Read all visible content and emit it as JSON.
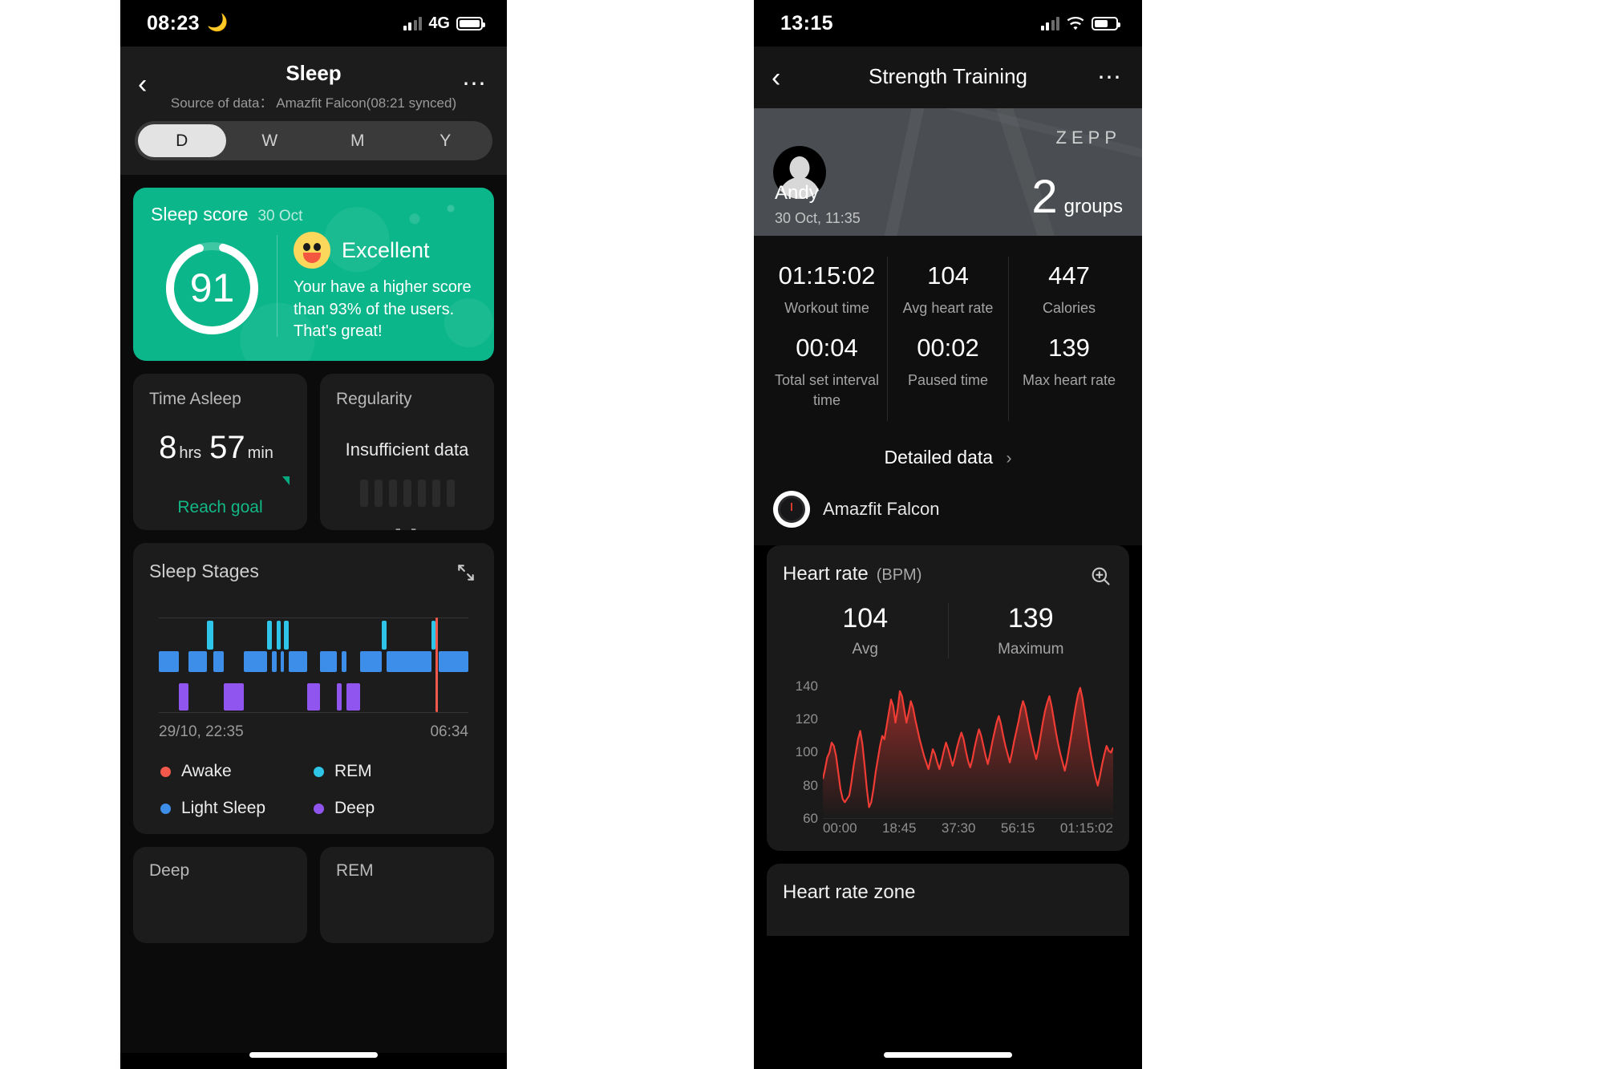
{
  "left": {
    "status": {
      "time": "08:23",
      "moon_icon": "moon-icon",
      "network": "4G"
    },
    "nav": {
      "back_icon": "chevron-left-icon",
      "title": "Sleep",
      "subtitle": "Source of data： Amazfit Falcon(08:21 synced)",
      "more_icon": "more-horizontal-icon"
    },
    "segments": [
      {
        "label": "D",
        "selected": true
      },
      {
        "label": "W",
        "selected": false
      },
      {
        "label": "M",
        "selected": false
      },
      {
        "label": "Y",
        "selected": false
      }
    ],
    "score_card": {
      "title": "Sleep score",
      "date": "30 Oct",
      "score": "91",
      "score_value": 91,
      "rating": "Excellent",
      "emoji_icon": "smiley-face-icon",
      "message": "Your have a higher score than 93% of the users. That's great!",
      "accent": "#0ab68a"
    },
    "time_asleep": {
      "title": "Time Asleep",
      "hours": "8",
      "hours_unit": "hrs",
      "minutes": "57",
      "minutes_unit": "min",
      "status": "Reach goal",
      "status_color": "#12b886"
    },
    "regularity": {
      "title": "Regularity",
      "value": "Insufficient data",
      "placeholder": "- -"
    },
    "sleep_stages": {
      "title": "Sleep Stages",
      "expand_icon": "expand-icon",
      "start_time": "29/10, 22:35",
      "end_time": "06:34",
      "legend": [
        {
          "label": "Awake",
          "color": "#f2584b"
        },
        {
          "label": "REM",
          "color": "#2ec5e8"
        },
        {
          "label": "Light Sleep",
          "color": "#3d8ee8"
        },
        {
          "label": "Deep",
          "color": "#9155ef"
        }
      ]
    },
    "bottom_cards": [
      {
        "title": "Deep"
      },
      {
        "title": "REM"
      }
    ],
    "chart_data": {
      "type": "area",
      "title": "Sleep Stages",
      "xlabel": "",
      "ylabel": "",
      "legend_position": "bottom",
      "categories": [
        "Awake",
        "REM",
        "Light Sleep",
        "Deep"
      ],
      "x": [
        "29/10, 22:35",
        "06:34"
      ],
      "segments": [
        {
          "stage": "Light Sleep",
          "start": 0.0,
          "end": 6.5
        },
        {
          "stage": "Deep",
          "start": 6.5,
          "end": 9.5
        },
        {
          "stage": "Light Sleep",
          "start": 9.5,
          "end": 15.5
        },
        {
          "stage": "REM",
          "start": 15.5,
          "end": 17.5
        },
        {
          "stage": "Light Sleep",
          "start": 17.5,
          "end": 21.0
        },
        {
          "stage": "Deep",
          "start": 21.0,
          "end": 27.5
        },
        {
          "stage": "Light Sleep",
          "start": 27.5,
          "end": 35.0
        },
        {
          "stage": "REM",
          "start": 35.0,
          "end": 36.5
        },
        {
          "stage": "Light Sleep",
          "start": 36.5,
          "end": 38.0
        },
        {
          "stage": "REM",
          "start": 38.0,
          "end": 39.5
        },
        {
          "stage": "Light Sleep",
          "start": 39.5,
          "end": 40.5
        },
        {
          "stage": "REM",
          "start": 40.5,
          "end": 42.0
        },
        {
          "stage": "Light Sleep",
          "start": 42.0,
          "end": 48.0
        },
        {
          "stage": "Deep",
          "start": 48.0,
          "end": 52.0
        },
        {
          "stage": "Light Sleep",
          "start": 52.0,
          "end": 57.5
        },
        {
          "stage": "Deep",
          "start": 57.5,
          "end": 59.0
        },
        {
          "stage": "Light Sleep",
          "start": 59.0,
          "end": 60.5
        },
        {
          "stage": "Deep",
          "start": 60.5,
          "end": 65.0
        },
        {
          "stage": "Light Sleep",
          "start": 65.0,
          "end": 72.0
        },
        {
          "stage": "REM",
          "start": 72.0,
          "end": 73.5
        },
        {
          "stage": "Light Sleep",
          "start": 73.5,
          "end": 88.0
        },
        {
          "stage": "REM",
          "start": 88.0,
          "end": 89.5
        },
        {
          "stage": "Awake",
          "start": 89.5,
          "end": 90.5
        },
        {
          "stage": "Light Sleep",
          "start": 90.5,
          "end": 100.0
        }
      ]
    }
  },
  "right": {
    "status": {
      "time": "13:15",
      "wifi_icon": "wifi-icon"
    },
    "nav": {
      "back_icon": "chevron-left-icon",
      "title": "Strength Training",
      "more_icon": "more-horizontal-icon"
    },
    "hero": {
      "avatar_icon": "avatar-icon",
      "user_name": "Andy",
      "datetime": "30 Oct, 11:35",
      "brand": "ΖΕΡΡ",
      "groups_value": "2",
      "groups_label": "groups"
    },
    "stats": [
      {
        "value": "01:15:02",
        "label": "Workout time"
      },
      {
        "value": "104",
        "label": "Avg heart rate"
      },
      {
        "value": "447",
        "label": "Calories"
      },
      {
        "value": "00:04",
        "label": "Total set interval time"
      },
      {
        "value": "00:02",
        "label": "Paused time"
      },
      {
        "value": "139",
        "label": "Max heart rate"
      }
    ],
    "detailed_data": {
      "label": "Detailed data",
      "chevron_icon": "chevron-right-icon"
    },
    "device": {
      "name": "Amazfit Falcon",
      "icon": "watch-icon"
    },
    "heart_rate": {
      "title": "Heart rate",
      "unit": "(BPM)",
      "zoom_icon": "zoom-in-icon",
      "avg_value": "104",
      "avg_label": "Avg",
      "max_value": "139",
      "max_label": "Maximum",
      "line_color": "#f03c34"
    },
    "heart_rate_zone": {
      "title": "Heart rate zone"
    },
    "chart_data": {
      "type": "line",
      "title": "Heart rate (BPM)",
      "xlabel": "",
      "ylabel": "BPM",
      "ylim": [
        60,
        150
      ],
      "yticks": [
        60,
        80,
        100,
        120,
        140
      ],
      "xticks": [
        "00:00",
        "18:45",
        "37:30",
        "56:15",
        "01:15:02"
      ],
      "grid": false,
      "legend_position": "none",
      "series": [
        {
          "name": "Heart rate",
          "color": "#f03c34",
          "values": [
            84,
            90,
            97,
            100,
            106,
            104,
            98,
            88,
            78,
            72,
            70,
            72,
            74,
            82,
            92,
            100,
            108,
            113,
            105,
            92,
            78,
            67,
            70,
            78,
            88,
            96,
            104,
            110,
            108,
            116,
            124,
            132,
            128,
            118,
            126,
            137,
            134,
            126,
            118,
            124,
            131,
            127,
            120,
            114,
            108,
            103,
            98,
            94,
            90,
            96,
            102,
            99,
            94,
            90,
            95,
            101,
            106,
            102,
            97,
            92,
            97,
            103,
            108,
            112,
            108,
            101,
            95,
            91,
            96,
            103,
            109,
            114,
            110,
            104,
            98,
            93,
            99,
            106,
            112,
            118,
            122,
            117,
            110,
            104,
            99,
            94,
            100,
            107,
            113,
            119,
            126,
            131,
            127,
            120,
            113,
            107,
            101,
            96,
            102,
            110,
            118,
            125,
            130,
            134,
            128,
            120,
            112,
            105,
            99,
            94,
            89,
            95,
            103,
            111,
            120,
            128,
            135,
            139,
            133,
            124,
            115,
            106,
            98,
            91,
            85,
            80,
            86,
            93,
            99,
            104,
            101,
            100,
            103
          ]
        }
      ]
    }
  }
}
